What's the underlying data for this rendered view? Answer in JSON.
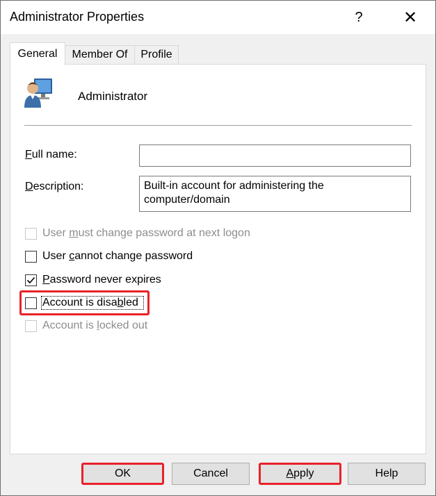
{
  "window": {
    "title": "Administrator Properties",
    "help_glyph": "?",
    "close_glyph": "✕"
  },
  "tabs": [
    {
      "label": "General",
      "active": true
    },
    {
      "label": "Member Of",
      "active": false
    },
    {
      "label": "Profile",
      "active": false
    }
  ],
  "user": {
    "icon": "user-monitor-icon",
    "name": "Administrator"
  },
  "fields": {
    "full_name": {
      "label_hotkey": "F",
      "label_rest": "ull name:",
      "value": ""
    },
    "description": {
      "label_hotkey": "D",
      "label_rest": "escription:",
      "value": "Built-in account for administering the computer/domain"
    }
  },
  "checkboxes": [
    {
      "pre": "User ",
      "hotkey": "m",
      "post": "ust change password at next logon",
      "checked": false,
      "enabled": false
    },
    {
      "pre": "User ",
      "hotkey": "c",
      "post": "annot change password",
      "checked": false,
      "enabled": true
    },
    {
      "pre": "",
      "hotkey": "P",
      "post": "assword never expires",
      "checked": true,
      "enabled": true
    },
    {
      "pre": "Account is disa",
      "hotkey": "b",
      "post": "led",
      "checked": false,
      "enabled": true
    },
    {
      "pre": "Account is ",
      "hotkey": "l",
      "post": "ocked out",
      "checked": false,
      "enabled": false
    }
  ],
  "buttons": {
    "ok": "OK",
    "cancel": "Cancel",
    "apply_hotkey": "A",
    "apply_rest": "pply",
    "help": "Help"
  },
  "colors": {
    "highlight": "#e8212a",
    "focus": "#0078d7"
  }
}
